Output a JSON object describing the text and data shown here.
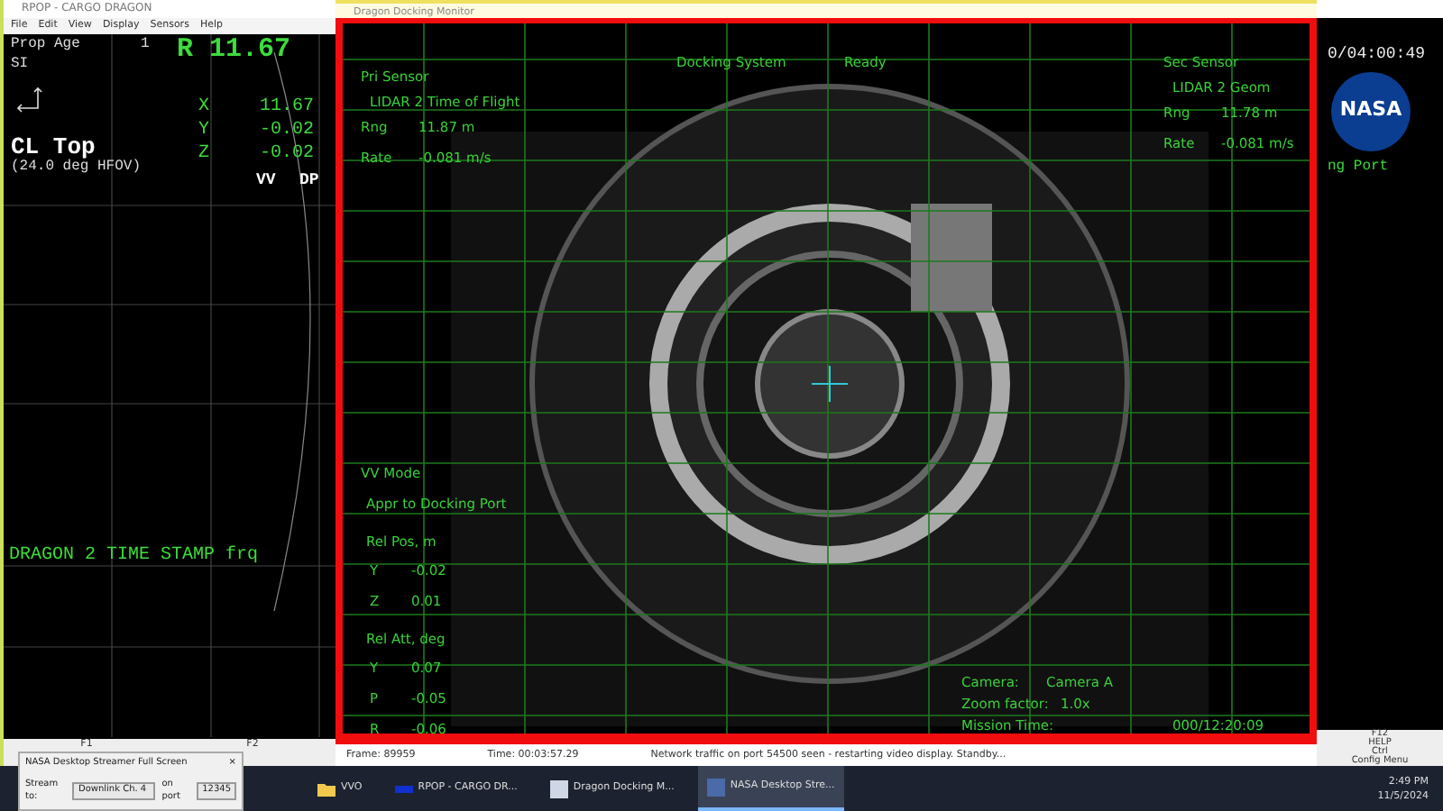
{
  "rpop_window": {
    "title": "RPOP - CARGO DRAGON",
    "menu": [
      "File",
      "Edit",
      "View",
      "Display",
      "Sensors",
      "Help"
    ],
    "prop_age_label": "Prop Age",
    "prop_age_value": "1",
    "range_readout": "R 11.67",
    "units": "SI",
    "axes": [
      {
        "axis": "X",
        "value": "11.67"
      },
      {
        "axis": "Y",
        "value": "-0.02"
      },
      {
        "axis": "Z",
        "value": "-0.02"
      }
    ],
    "camera_view": "CL Top",
    "fov": "(24.0 deg HFOV)",
    "modes": [
      "VV",
      "DP"
    ],
    "timestamp_banner": "DRAGON 2 TIME STAMP frq",
    "function_keys": [
      "F1",
      "F2"
    ]
  },
  "docking_monitor": {
    "title": "Dragon Docking Monitor",
    "primary_sensor": {
      "heading": "Pri Sensor",
      "name": "LIDAR 2 Time of Flight",
      "readings": [
        {
          "label": "Rng",
          "value": "11.87 m"
        },
        {
          "label": "Rate",
          "value": "-0.081 m/s"
        }
      ]
    },
    "system": {
      "label": "Docking System",
      "status": "Ready"
    },
    "secondary_sensor": {
      "heading": "Sec Sensor",
      "name": "LIDAR 2 Geom",
      "readings": [
        {
          "label": "Rng",
          "value": "11.78 m"
        },
        {
          "label": "Rate",
          "value": "-0.081 m/s"
        }
      ]
    },
    "vv_mode": {
      "heading": "VV Mode",
      "value": "Appr to Docking Port"
    },
    "rel_pos": {
      "heading": "Rel Pos, m",
      "rows": [
        {
          "label": "Y",
          "value": "-0.02"
        },
        {
          "label": "Z",
          "value": "0.01"
        }
      ]
    },
    "rel_att": {
      "heading": "Rel Att, deg",
      "rows": [
        {
          "label": "Y",
          "value": "0.07"
        },
        {
          "label": "P",
          "value": "-0.05"
        },
        {
          "label": "R",
          "value": "-0.06"
        }
      ]
    },
    "camera_info": [
      {
        "label": "Camera:",
        "value": "Camera A"
      },
      {
        "label": "Zoom factor:",
        "value": "1.0x"
      },
      {
        "label": "Mission Time:",
        "value": "000/12:20:09"
      }
    ],
    "status_bar": [
      "Frame: 89959",
      "Time: 00:03:57.29",
      "Network traffic on port 54500 seen - restarting video display. Standby..."
    ]
  },
  "side_panel": {
    "clock": "0/04:00:49",
    "logo_text": "NASA",
    "port_label": "ng Port",
    "keys": [
      "F12",
      "HELP",
      "Ctrl",
      "Config Menu"
    ]
  },
  "streamer_dialog": {
    "title": "NASA Desktop Streamer Full Screen",
    "stream_label": "Stream to:",
    "stream_value": "Downlink Ch. 4",
    "port_label": "on port",
    "port_value": "12345",
    "close_glyph": "×"
  },
  "taskbar": {
    "apps": [
      {
        "kind": "folder",
        "label": "VVO",
        "selected": false
      },
      {
        "kind": "rpop",
        "label": "RPOP - CARGO DR...",
        "selected": false
      },
      {
        "kind": "monitor",
        "label": "Dragon Docking M...",
        "selected": false
      },
      {
        "kind": "streamer",
        "label": "NASA Desktop Stre...",
        "selected": true
      }
    ],
    "time": "2:49 PM",
    "date": "11/5/2024"
  }
}
